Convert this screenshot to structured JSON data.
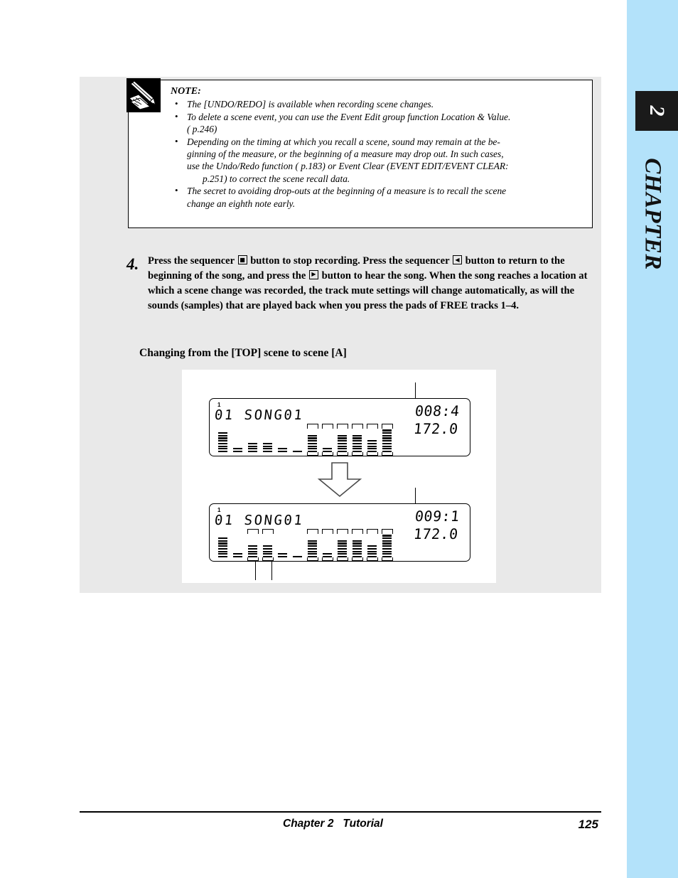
{
  "sidebar": {
    "chapter_number": "2",
    "chapter_word": "CHAPTER",
    "background_color": "#b3e2fa",
    "box_color": "#1a1a1a"
  },
  "note": {
    "icon_name": "pencil-writing-icon",
    "title": "NOTE:",
    "items": [
      "The [UNDO/REDO] is available when recording scene changes.",
      "To delete a scene event, you can use the Event Edit group function Location & Value.",
      "Depending on the timing at which you recall a scene, sound may remain at the be-",
      "The secret to avoiding drop-outs at the beginning of a measure is to recall the scene"
    ],
    "item2_cont": "(    p.246)",
    "item3_cont1": "ginning of the measure, or the beginning of a measure may drop out. In such cases,",
    "item3_cont2": "use the Undo/Redo function (    p.183) or Event Clear (EVENT EDIT/EVENT CLEAR:",
    "item3_cont3": "p.251) to correct the scene recall data.",
    "item4_cont": "change an eighth note early."
  },
  "step": {
    "number": "4.",
    "line1a": "Press the sequencer",
    "line1b": "button to stop recording. Press the sequencer",
    "line1c": "button to",
    "line2a": "return to the beginning of the song, and press the",
    "line2b": "button to hear the song. When",
    "line3": "the song reaches a location at which a scene change was recorded, the track mute",
    "line4": "settings will change automatically, as will the sounds (samples) that are played back",
    "line5": "when you press the pads of FREE tracks 1–4.",
    "icon_stop": "■",
    "icon_rewind": "◀",
    "icon_play": "▶"
  },
  "subheading": "Changing from the [TOP] scene to scene [A]",
  "figure": {
    "lcd_top": {
      "superscript": "1",
      "song": "01 SONG01",
      "measure": "008:4",
      "tempo": "172.0",
      "meters": [
        {
          "level": 8,
          "bracketed": false
        },
        {
          "level": 2,
          "bracketed": false
        },
        {
          "level": 4,
          "bracketed": false
        },
        {
          "level": 4,
          "bracketed": false
        },
        {
          "level": 2,
          "bracketed": false
        },
        {
          "level": 1,
          "bracketed": false
        },
        {
          "level": 7,
          "bracketed": true
        },
        {
          "level": 2,
          "bracketed": true
        },
        {
          "level": 7,
          "bracketed": true
        },
        {
          "level": 7,
          "bracketed": true
        },
        {
          "level": 5,
          "bracketed": true
        },
        {
          "level": 9,
          "bracketed": true
        }
      ]
    },
    "lcd_bottom": {
      "superscript": "1",
      "song": "01 SONG01",
      "measure": "009:1",
      "tempo": "172.0",
      "meters": [
        {
          "level": 8,
          "bracketed": false
        },
        {
          "level": 2,
          "bracketed": false
        },
        {
          "level": 5,
          "bracketed": true
        },
        {
          "level": 5,
          "bracketed": true
        },
        {
          "level": 2,
          "bracketed": false
        },
        {
          "level": 1,
          "bracketed": false
        },
        {
          "level": 7,
          "bracketed": true
        },
        {
          "level": 2,
          "bracketed": true
        },
        {
          "level": 7,
          "bracketed": true
        },
        {
          "level": 7,
          "bracketed": true
        },
        {
          "level": 5,
          "bracketed": true
        },
        {
          "level": 9,
          "bracketed": true
        }
      ]
    },
    "arrow_name": "down-arrow"
  },
  "footer": {
    "center": "Chapter 2   Tutorial",
    "page": "125"
  }
}
